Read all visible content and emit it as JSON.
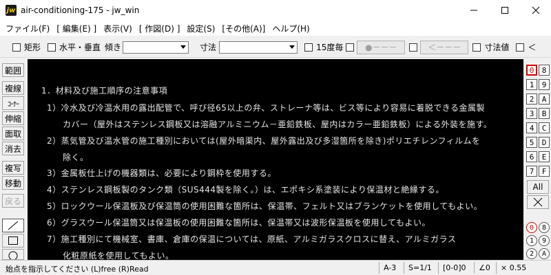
{
  "window": {
    "title": "air-conditioning-175 - jw_win",
    "icon_text": "jw",
    "controls": [
      "minimize",
      "maximize",
      "close"
    ]
  },
  "menu": [
    "ファイル(F)",
    "[ 編集(E) ]",
    "表示(V)",
    "[ 作図(D) ]",
    "設定(S)",
    "[その他(A)]",
    "ヘルプ(H)"
  ],
  "toolbar": {
    "rect_label": "矩形",
    "horiz_vert_label": "水平・垂直",
    "angle_label": "傾き",
    "dimension_label": "寸法",
    "deg15_label": "15度毎",
    "dot_button": "●－－－",
    "arrow_button": "＜－－－",
    "dim_value_label": "寸法値",
    "lt_label": "＜"
  },
  "left_tools": {
    "buttons": [
      "範囲",
      "複線",
      "ｺｰﾅｰ",
      "伸縮",
      "面取",
      "消去",
      "複写",
      "移動",
      "戻る"
    ],
    "draw_tools": [
      "line-tool-icon",
      "rectangle-tool-icon",
      "circle-tool-icon"
    ]
  },
  "canvas": {
    "background": "#000000",
    "text_color": "#e6e6e6",
    "lines": [
      "1．材料及び施工順序の注意事項",
      "1）冷水及び冷温水用の露出配管で、呼び径65以上の弁、ストレーナ等は、ビス等により容易に着脱できる金属製",
      "カバー（屋外はステンレス鋼板又は溶融アルミニウム－亜鉛鉄板、屋内はカラー亜鉛鉄板）による外装を施す。",
      "2）蒸気管及び温水管の施工種別においては(屋外暗渠内、屋外露出及び多湿箇所を除き)ポリエチレンフィルムを",
      "除く。",
      "3）金属板仕上げの機器類は、必要により鋼枠を使用する。",
      "4）ステンレス鋼板製のタンク類（SUS444製を除く。）は、エポキシ系塗装により保温材と絶縁する。",
      "5）ロックウール保温板及び保温筒の使用困難な箇所は、保温帯、フェルト又はブランケットを使用してもよい。",
      "6）グラスウール保温筒又は保温板の使用困難な箇所は、保温帯又は波形保温板を使用してもよい。",
      "7）施工種別にて機械室、書庫、倉庫の保温については、原紙、アルミガラスクロスに替え、アルミガラス",
      "化粧原紙を使用してもよい。"
    ]
  },
  "layers": {
    "active": "0",
    "accent_color": "#d00000",
    "cells": [
      "0",
      "8",
      "1",
      "9",
      "2",
      "A",
      "3",
      "B",
      "4",
      "C",
      "5",
      "D",
      "6",
      "E",
      "7",
      "F"
    ],
    "all_label": "All",
    "group_cells": [
      "0",
      "8",
      "1",
      "9",
      "2",
      "A"
    ]
  },
  "status": {
    "message": "始点を指示してください (L)free (R)Read",
    "paper": "A-3",
    "scale": "S=1/1",
    "group": "[0-0]0",
    "angle": "∠0",
    "zoom": "× 0.55"
  }
}
